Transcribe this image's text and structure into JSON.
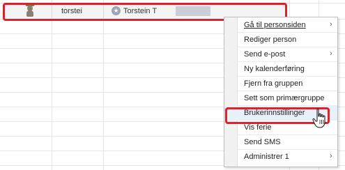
{
  "user_row": {
    "username": "torstei",
    "fullname": "Torstein T",
    "star_icon": "star-icon",
    "avatar_icon": "person-icon"
  },
  "context_menu": {
    "items": [
      {
        "label": "Gå til personsiden",
        "submenu": true
      },
      {
        "label": "Rediger person",
        "submenu": false
      },
      {
        "label": "Send e-post",
        "submenu": true
      },
      {
        "label": "Ny kalenderføring",
        "submenu": false
      },
      {
        "label": "Fjern fra gruppen",
        "submenu": false
      },
      {
        "label": "Sett som primærgruppe",
        "submenu": false
      },
      {
        "label": "Brukerinnstillinger",
        "submenu": false
      },
      {
        "label": "Vis ferie",
        "submenu": false
      },
      {
        "label": "Send SMS",
        "submenu": false
      },
      {
        "label": "Administrer 1",
        "submenu": true
      }
    ],
    "arrow_glyph": "›",
    "hovered_index": 6
  },
  "colors": {
    "highlight": "#e3202a",
    "hover": "#e8f0f8"
  },
  "cursor_icon": "hand-pointer-icon"
}
